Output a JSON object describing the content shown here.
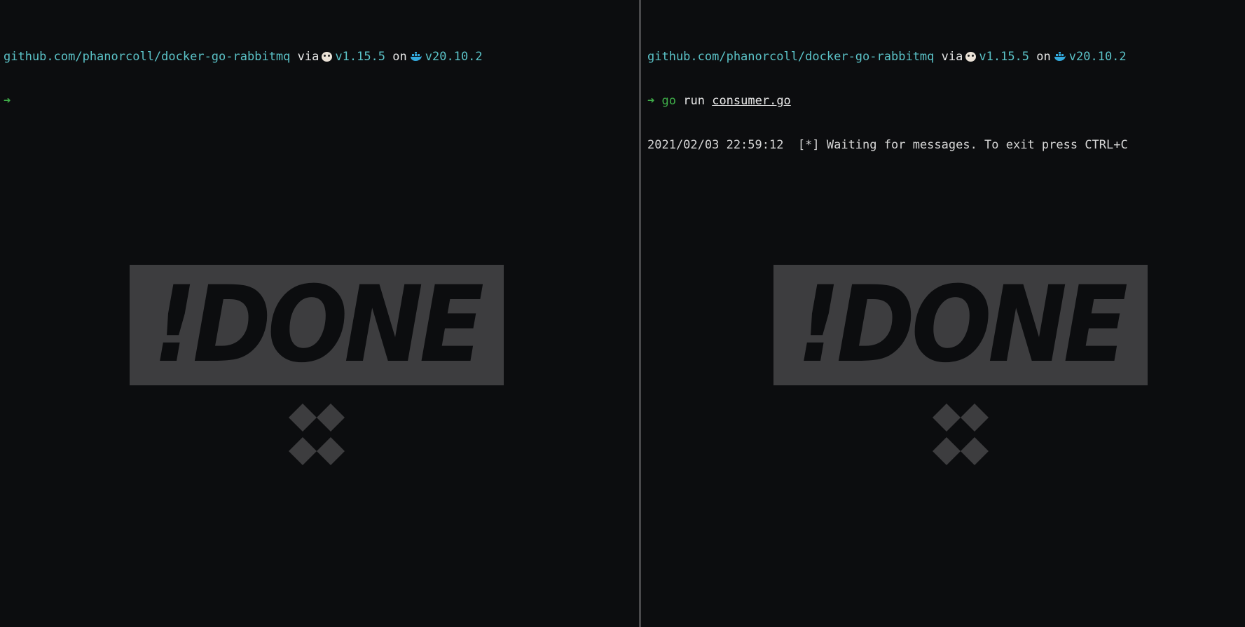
{
  "left_pane": {
    "prompt": {
      "path": "github.com/phanorcoll/docker-go-rabbitmq",
      "via": "via",
      "go_icon": "gopher-icon",
      "go_version": "v1.15.5",
      "on": "on",
      "docker_icon": "docker-whale-icon",
      "docker_version": "v20.10.2"
    },
    "input_line": {
      "arrow": "➜"
    }
  },
  "right_pane": {
    "prompt": {
      "path": "github.com/phanorcoll/docker-go-rabbitmq",
      "via": "via",
      "go_icon": "gopher-icon",
      "go_version": "v1.15.5",
      "on": "on",
      "docker_icon": "docker-whale-icon",
      "docker_version": "v20.10.2"
    },
    "input_line": {
      "arrow": "➜",
      "command": "go",
      "subcommand": "run",
      "file": "consumer.go"
    },
    "output_line": "2021/02/03 22:59:12  [*] Waiting for messages. To exit press CTRL+C"
  },
  "watermark": {
    "text": "!DONE"
  },
  "colors": {
    "background": "#0c0d0f",
    "path": "#5bc3c8",
    "prompt_arrow": "#3fae49",
    "output": "#d6d6d6",
    "watermark_box": "#3d3d3f"
  }
}
